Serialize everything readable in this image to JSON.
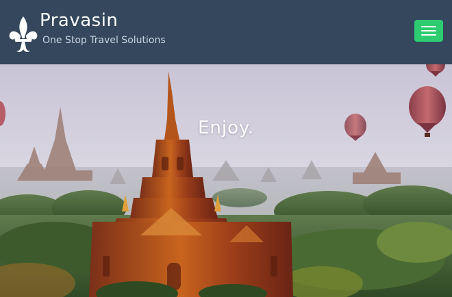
{
  "brand": {
    "name": "Pravasin",
    "tagline": "One Stop Travel Solutions",
    "logo_icon": "fleur-de-lis-icon"
  },
  "nav": {
    "toggle_icon": "hamburger-menu-icon",
    "toggle_color": "#2ecc71"
  },
  "hero": {
    "headline": "Enjoy.",
    "image": "temple-and-hot-air-balloons"
  },
  "colors": {
    "navbar": "#34475c",
    "accent": "#2ecc71"
  }
}
